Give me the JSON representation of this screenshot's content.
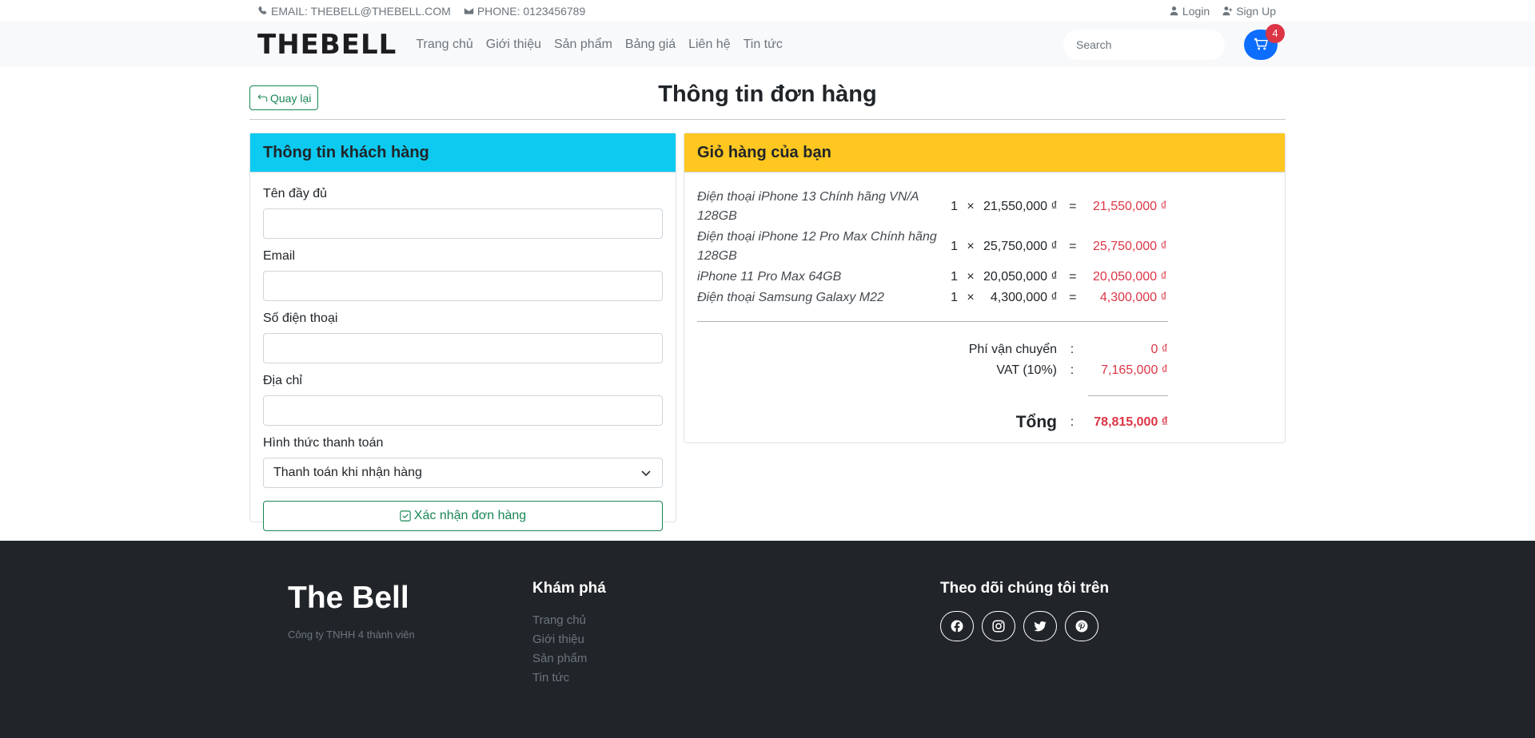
{
  "topbar": {
    "email": "EMAIL: THEBELL@THEBELL.COM",
    "phone": "PHONE: 0123456789",
    "login": "Login",
    "signup": "Sign Up"
  },
  "navbar": {
    "logo": "THEBELL",
    "items": [
      "Trang chủ",
      "Giới thiệu",
      "Sản phẩm",
      "Bảng giá",
      "Liên hệ",
      "Tin tức"
    ],
    "search_placeholder": "Search",
    "cart_count": "4"
  },
  "page": {
    "back_label": "Quay lại",
    "title": "Thông tin đơn hàng"
  },
  "customer_form": {
    "heading": "Thông tin khách hàng",
    "fullname_label": "Tên đầy đủ",
    "email_label": "Email",
    "phone_label": "Số điện thoại",
    "address_label": "Địa chỉ",
    "payment_label": "Hình thức thanh toán",
    "payment_selected": "Thanh toán khi nhận hàng",
    "confirm_label": "Xác nhận đơn hàng"
  },
  "cart": {
    "heading": "Giỏ hàng của bạn",
    "items": [
      {
        "name": "Điện thoại iPhone 13 Chính hãng VN/A 128GB",
        "qty": "1",
        "times": "×",
        "price": "21,550,000 ₫",
        "eq": "=",
        "total": "21,550,000 ₫"
      },
      {
        "name": "Điện thoại iPhone 12 Pro Max Chính hãng 128GB",
        "qty": "1",
        "times": "×",
        "price": "25,750,000 ₫",
        "eq": "=",
        "total": "25,750,000 ₫"
      },
      {
        "name": "iPhone 11 Pro Max 64GB",
        "qty": "1",
        "times": "×",
        "price": "20,050,000 ₫",
        "eq": "=",
        "total": "20,050,000 ₫"
      },
      {
        "name": "Điện thoại Samsung Galaxy M22",
        "qty": "1",
        "times": "×",
        "price": "4,300,000 ₫",
        "eq": "=",
        "total": "4,300,000 ₫"
      }
    ],
    "shipping_label": "Phí vận chuyển",
    "shipping_value": "0 ₫",
    "vat_label": "VAT (10%)",
    "vat_value": "7,165,000 ₫",
    "colon": ":",
    "total_label": "Tổng",
    "total_value": "78,815,000 ₫"
  },
  "footer": {
    "brand": "The Bell",
    "company": "Công ty TNHH 4 thành viên",
    "explore_heading": "Khám phá",
    "explore_links": [
      "Trang chủ",
      "Giới thiệu",
      "Sản phẩm",
      "Tin tức"
    ],
    "follow_heading": "Theo dõi chúng tôi trên",
    "social_icons": [
      "facebook-icon",
      "instagram-icon",
      "twitter-icon",
      "pinterest-icon"
    ]
  },
  "colors": {
    "info": "#0dcaf0",
    "warning": "#ffc720",
    "success": "#198754",
    "danger": "#dc3545",
    "primary": "#0d6efd",
    "dark": "#212529"
  }
}
